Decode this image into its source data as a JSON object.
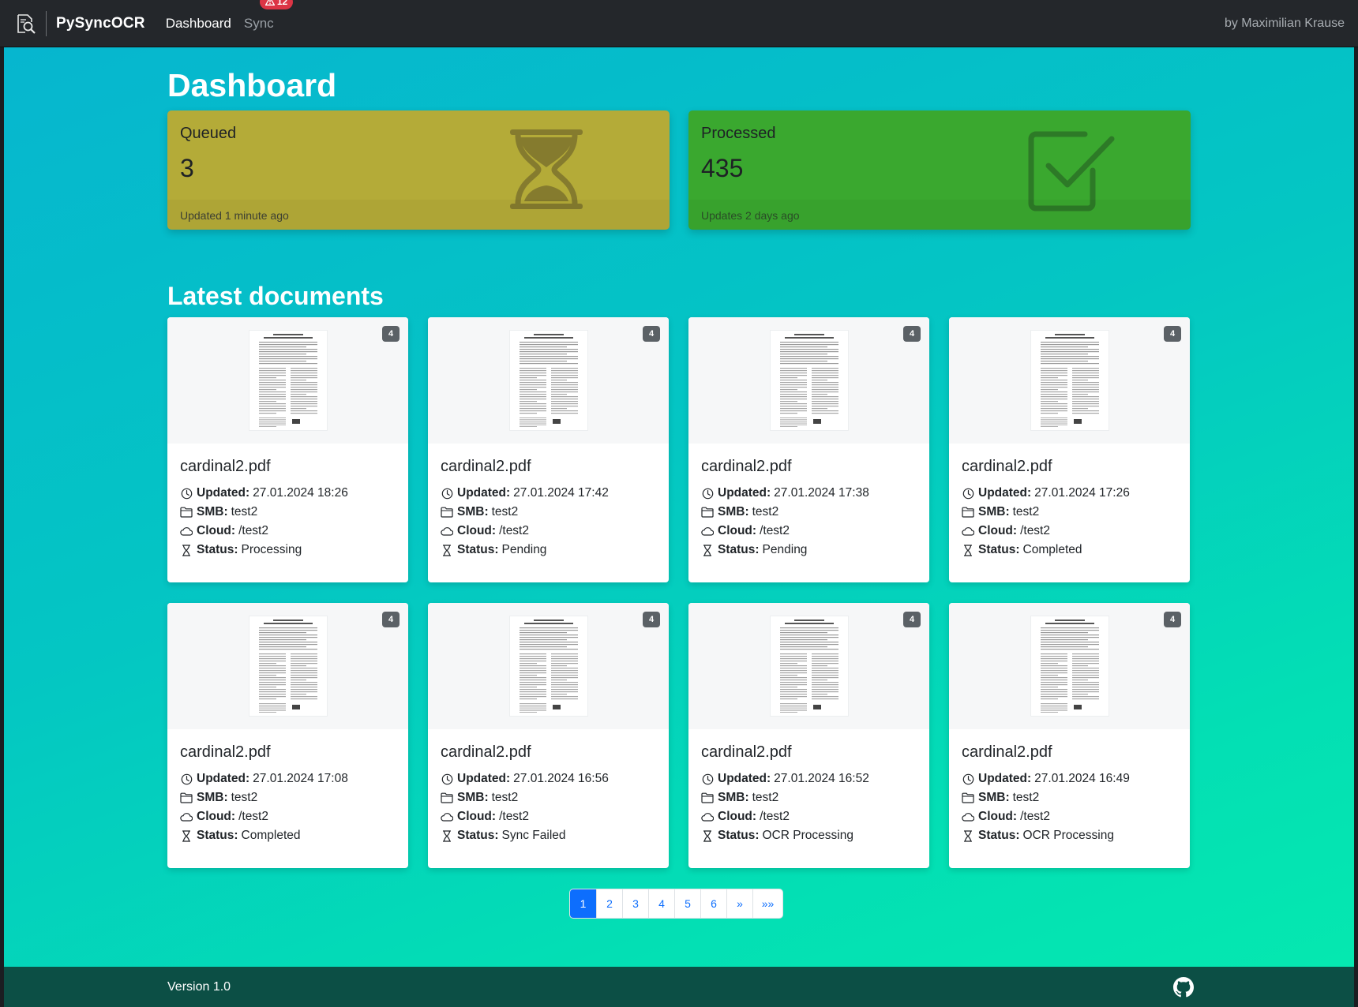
{
  "navbar": {
    "brand": "PySyncOCR",
    "links": [
      {
        "label": "Dashboard"
      },
      {
        "label": "Sync",
        "badge": "12"
      }
    ],
    "author": "by Maximilian Krause"
  },
  "dashboard": {
    "title": "Dashboard",
    "stats": [
      {
        "label": "Queued",
        "value": "3",
        "footer": "Updated 1 minute ago",
        "icon": "hourglass-icon",
        "color": "#b4ab38"
      },
      {
        "label": "Processed",
        "value": "435",
        "footer": "Updates 2 days ago",
        "icon": "checkbox-checked-icon",
        "color": "#3aa82f"
      }
    ]
  },
  "documents": {
    "title": "Latest documents",
    "labels": {
      "updated": "Updated:",
      "smb": "SMB:",
      "cloud": "Cloud:",
      "status": "Status:"
    },
    "items": [
      {
        "name": "cardinal2.pdf",
        "pages": "4",
        "updated": "27.01.2024 18:26",
        "smb": "test2",
        "cloud": "/test2",
        "status": "Processing"
      },
      {
        "name": "cardinal2.pdf",
        "pages": "4",
        "updated": "27.01.2024 17:42",
        "smb": "test2",
        "cloud": "/test2",
        "status": "Pending"
      },
      {
        "name": "cardinal2.pdf",
        "pages": "4",
        "updated": "27.01.2024 17:38",
        "smb": "test2",
        "cloud": "/test2",
        "status": "Pending"
      },
      {
        "name": "cardinal2.pdf",
        "pages": "4",
        "updated": "27.01.2024 17:26",
        "smb": "test2",
        "cloud": "/test2",
        "status": "Completed"
      },
      {
        "name": "cardinal2.pdf",
        "pages": "4",
        "updated": "27.01.2024 17:08",
        "smb": "test2",
        "cloud": "/test2",
        "status": "Completed"
      },
      {
        "name": "cardinal2.pdf",
        "pages": "4",
        "updated": "27.01.2024 16:56",
        "smb": "test2",
        "cloud": "/test2",
        "status": "Sync Failed"
      },
      {
        "name": "cardinal2.pdf",
        "pages": "4",
        "updated": "27.01.2024 16:52",
        "smb": "test2",
        "cloud": "/test2",
        "status": "OCR Processing"
      },
      {
        "name": "cardinal2.pdf",
        "pages": "4",
        "updated": "27.01.2024 16:49",
        "smb": "test2",
        "cloud": "/test2",
        "status": "OCR Processing"
      }
    ]
  },
  "pagination": {
    "pages": [
      "1",
      "2",
      "3",
      "4",
      "5",
      "6"
    ],
    "active": "1",
    "next": "»",
    "last": "»»"
  },
  "footer": {
    "version": "Version 1.0",
    "icon": "github-icon"
  }
}
